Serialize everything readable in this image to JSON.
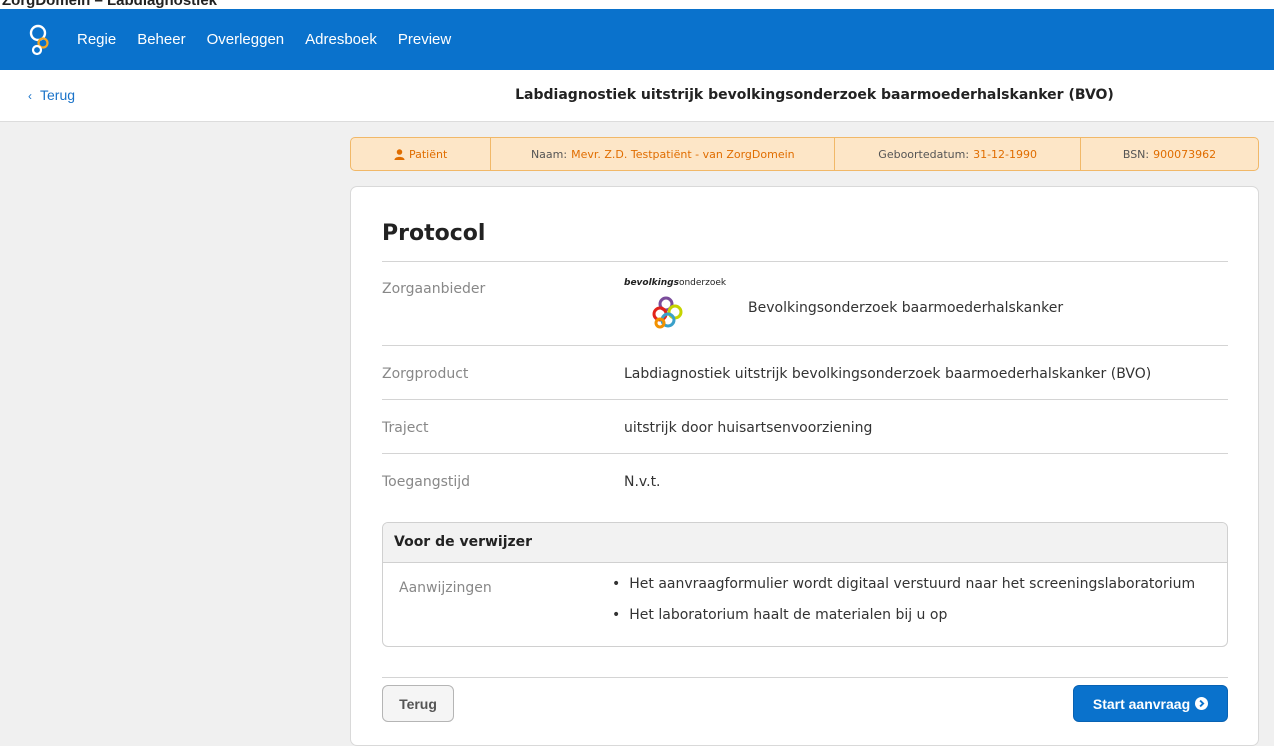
{
  "top_strip": {
    "text": "ZorgDomein – Labdiagnostiek"
  },
  "nav": {
    "logo_icon": "zorgdomein-logo-icon",
    "items": [
      {
        "label": "Regie"
      },
      {
        "label": "Beheer"
      },
      {
        "label": "Overleggen"
      },
      {
        "label": "Adresboek"
      },
      {
        "label": "Preview"
      }
    ],
    "color": "#0a72cc"
  },
  "subheader": {
    "back_label": "Terug",
    "title": "Labdiagnostiek uitstrijk bevolkingsonderzoek baarmoederhalskanker (BVO)"
  },
  "patient": {
    "section_label": "Patiënt",
    "naam_label": "Naam:",
    "naam_value": "Mevr. Z.D. Testpatiënt - van ZorgDomein",
    "geboortedatum_label": "Geboortedatum:",
    "geboortedatum_value": "31-12-1990",
    "bsn_label": "BSN:",
    "bsn_value": "900073962",
    "accent": "#e06d00"
  },
  "protocol": {
    "title": "Protocol",
    "rows": [
      {
        "label": "Zorgaanbieder",
        "value": "Bevolkingsonderzoek baarmoederhalskanker",
        "logo_bold": "bevolkings",
        "logo_rest": "onderzoek"
      },
      {
        "label": "Zorgproduct",
        "value": "Labdiagnostiek uitstrijk bevolkingsonderzoek baarmoederhalskanker (BVO)"
      },
      {
        "label": "Traject",
        "value": "uitstrijk door huisartsenvoorziening"
      },
      {
        "label": "Toegangstijd",
        "value": "N.v.t."
      }
    ]
  },
  "verwijzer": {
    "title": "Voor de verwijzer",
    "label": "Aanwijzingen",
    "items": [
      "Het aanvraagformulier wordt digitaal verstuurd naar het screeningslaboratorium",
      "Het laboratorium haalt de materialen bij u op"
    ]
  },
  "buttons": {
    "back": "Terug",
    "start": "Start aanvraag"
  }
}
